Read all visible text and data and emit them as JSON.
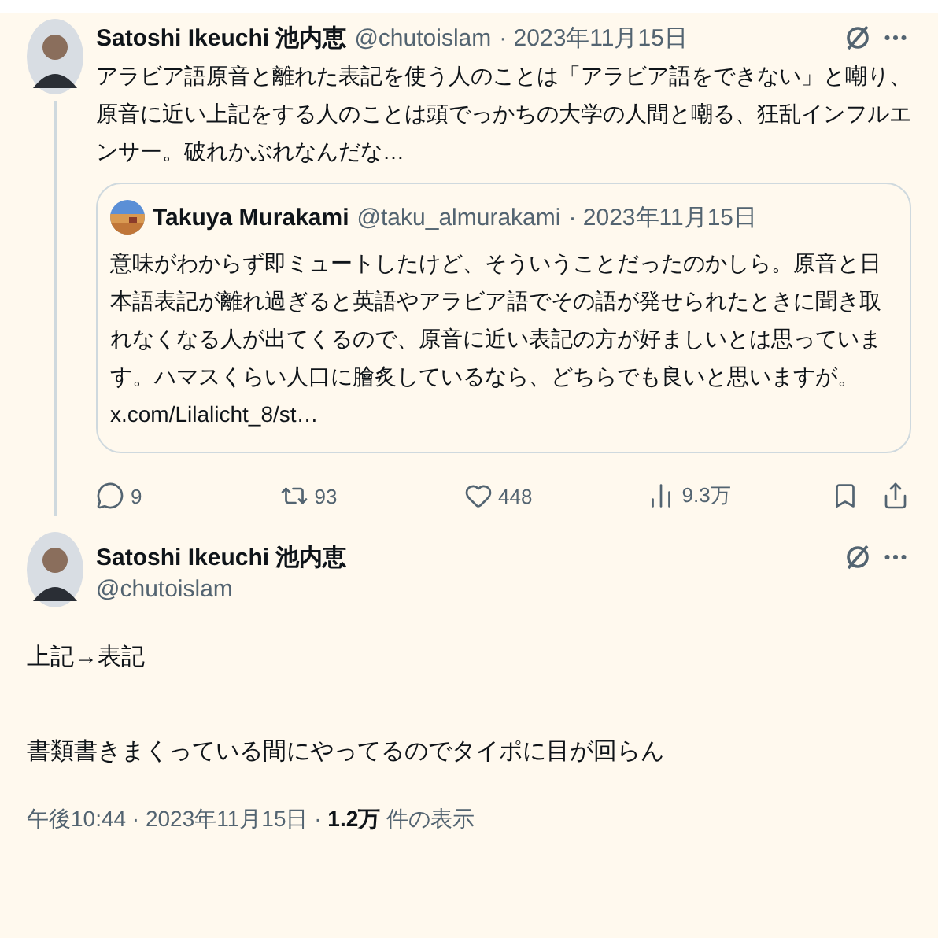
{
  "tweets": [
    {
      "author": {
        "name": "Satoshi Ikeuchi 池内恵",
        "handle": "@chutoislam",
        "date": "· 2023年11月15日"
      },
      "text": "アラビア語原音と離れた表記を使う人のことは「アラビア語をできない」と嘲り、原音に近い上記をする人のことは頭でっかちの大学の人間と嘲る、狂乱インフルエンサー。破れかぶれなんだな…",
      "quote": {
        "name": "Takuya Murakami",
        "handle": "@taku_almurakami",
        "date": "· 2023年11月15日",
        "text": "意味がわからず即ミュートしたけど、そういうことだったのかしら。原音と日本語表記が離れ過ぎると英語やアラビア語でその語が発せられたときに聞き取れなくなる人が出てくるので、原音に近い表記の方が好ましいとは思っています。ハマスくらい人口に膾炙しているなら、どちらでも良いと思いますが。",
        "link": "x.com/Lilalicht_8/st…"
      },
      "actions": [
        {
          "kind": "reply",
          "count": "9"
        },
        {
          "kind": "repost",
          "count": "93"
        },
        {
          "kind": "like",
          "count": "448"
        },
        {
          "kind": "views",
          "count": "9.3万"
        },
        {
          "kind": "bookmark"
        },
        {
          "kind": "share"
        }
      ]
    },
    {
      "author": {
        "name": "Satoshi Ikeuchi 池内恵",
        "handle": "@chutoislam"
      },
      "paragraphs": [
        "上記→表記",
        "書類書きまくっている間にやってるのでタイポに目が回らん"
      ],
      "meta": "午後10:44 · 2023年11月15日 · **1.2万** 件の表示"
    }
  ]
}
